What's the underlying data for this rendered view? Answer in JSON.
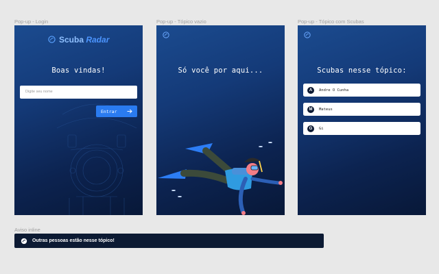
{
  "frames": {
    "login": {
      "label": "Pop-up - Login",
      "brand_part1": "Scuba",
      "brand_part2": "Radar",
      "heading": "Boas vindas!",
      "input_placeholder": "Digite seu nome",
      "enter_label": "Entrar",
      "logo_icon": "scuba-radar-logo-icon",
      "arrow_icon": "arrow-right-icon"
    },
    "empty": {
      "label": "Pop-up - Tópico vazio",
      "heading": "Só você por aqui...",
      "logo_icon": "scuba-radar-logo-icon",
      "illustration": "diver-illustration"
    },
    "with_scubas": {
      "label": "Pop-up - Tópico com Scubas",
      "heading": "Scubas nesse tópico:",
      "logo_icon": "scuba-radar-logo-icon",
      "scubas": [
        {
          "initial": "A",
          "name": "Andre O Cunha"
        },
        {
          "initial": "M",
          "name": "Mateus"
        },
        {
          "initial": "G",
          "name": "Gi"
        }
      ]
    }
  },
  "inline_alert": {
    "label": "Aviso inline",
    "message": "Outras pessoas estão nesse tópico!",
    "icon": "scuba-radar-logo-icon"
  },
  "colors": {
    "background": "#e8e8e8",
    "frame_top": "#1b4b8f",
    "frame_bottom": "#081838",
    "accent": "#2a7bf0",
    "alert_bg": "#0c1a33"
  }
}
